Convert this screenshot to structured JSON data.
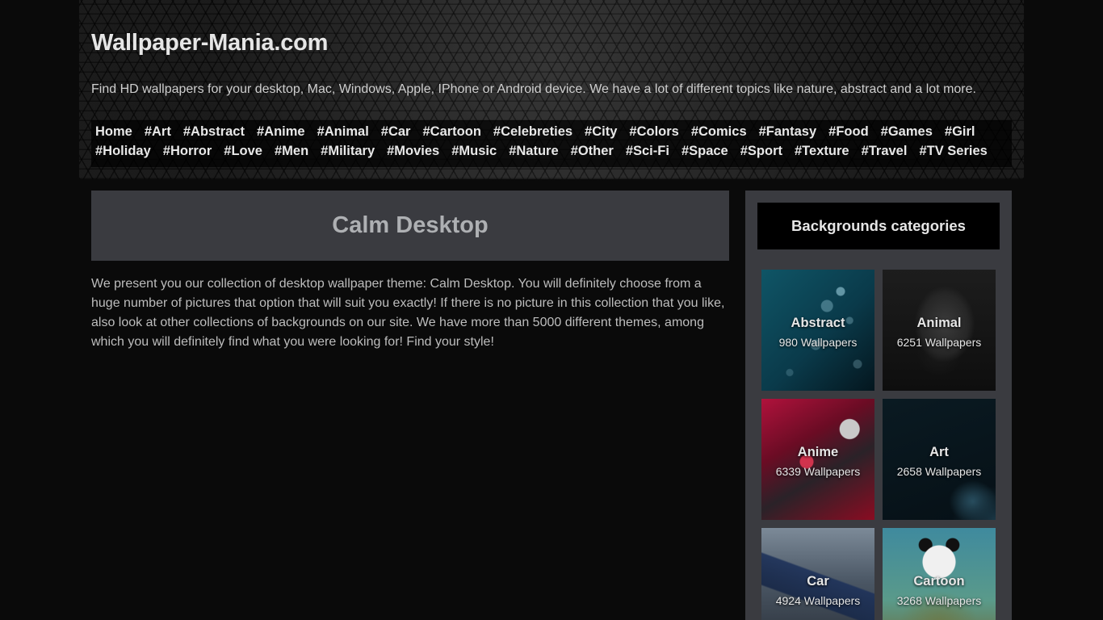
{
  "header": {
    "site_title": "Wallpaper-Mania.com",
    "tagline": "Find HD wallpapers for your desktop, Mac, Windows, Apple, IPhone or Android device. We have a lot of different topics like nature, abstract and a lot more."
  },
  "nav": {
    "items": [
      {
        "label": "Home"
      },
      {
        "label": "#Art"
      },
      {
        "label": "#Abstract"
      },
      {
        "label": "#Anime"
      },
      {
        "label": "#Animal"
      },
      {
        "label": "#Car"
      },
      {
        "label": "#Cartoon"
      },
      {
        "label": "#Celebreties"
      },
      {
        "label": "#City"
      },
      {
        "label": "#Colors"
      },
      {
        "label": "#Comics"
      },
      {
        "label": "#Fantasy"
      },
      {
        "label": "#Food"
      },
      {
        "label": "#Games"
      },
      {
        "label": "#Girl"
      },
      {
        "label": "#Holiday"
      },
      {
        "label": "#Horror"
      },
      {
        "label": "#Love"
      },
      {
        "label": "#Men"
      },
      {
        "label": "#Military"
      },
      {
        "label": "#Movies"
      },
      {
        "label": "#Music"
      },
      {
        "label": "#Nature"
      },
      {
        "label": "#Other"
      },
      {
        "label": "#Sci-Fi"
      },
      {
        "label": "#Space"
      },
      {
        "label": "#Sport"
      },
      {
        "label": "#Texture"
      },
      {
        "label": "#Travel"
      },
      {
        "label": "#TV Series"
      }
    ]
  },
  "main": {
    "title": "Calm Desktop",
    "description": "We present you our collection of desktop wallpaper theme: Calm Desktop. You will definitely choose from a huge number of pictures that option that will suit you exactly! If there is no picture in this collection that you like, also look at other collections of backgrounds on our site. We have more than 5000 different themes, among which you will definitely find what you were looking for! Find your style!"
  },
  "sidebar": {
    "heading": "Backgrounds categories",
    "categories": [
      {
        "name": "Abstract",
        "count": "980 Wallpapers"
      },
      {
        "name": "Animal",
        "count": "6251 Wallpapers"
      },
      {
        "name": "Anime",
        "count": "6339 Wallpapers"
      },
      {
        "name": "Art",
        "count": "2658 Wallpapers"
      },
      {
        "name": "Car",
        "count": "4924 Wallpapers"
      },
      {
        "name": "Cartoon",
        "count": "3268 Wallpapers"
      }
    ]
  },
  "colors": {
    "page_bg": "#0a0a0a",
    "panel_bg": "#3a3b40",
    "text": "#cfcfcf",
    "heading_text": "#aeb0b3"
  }
}
